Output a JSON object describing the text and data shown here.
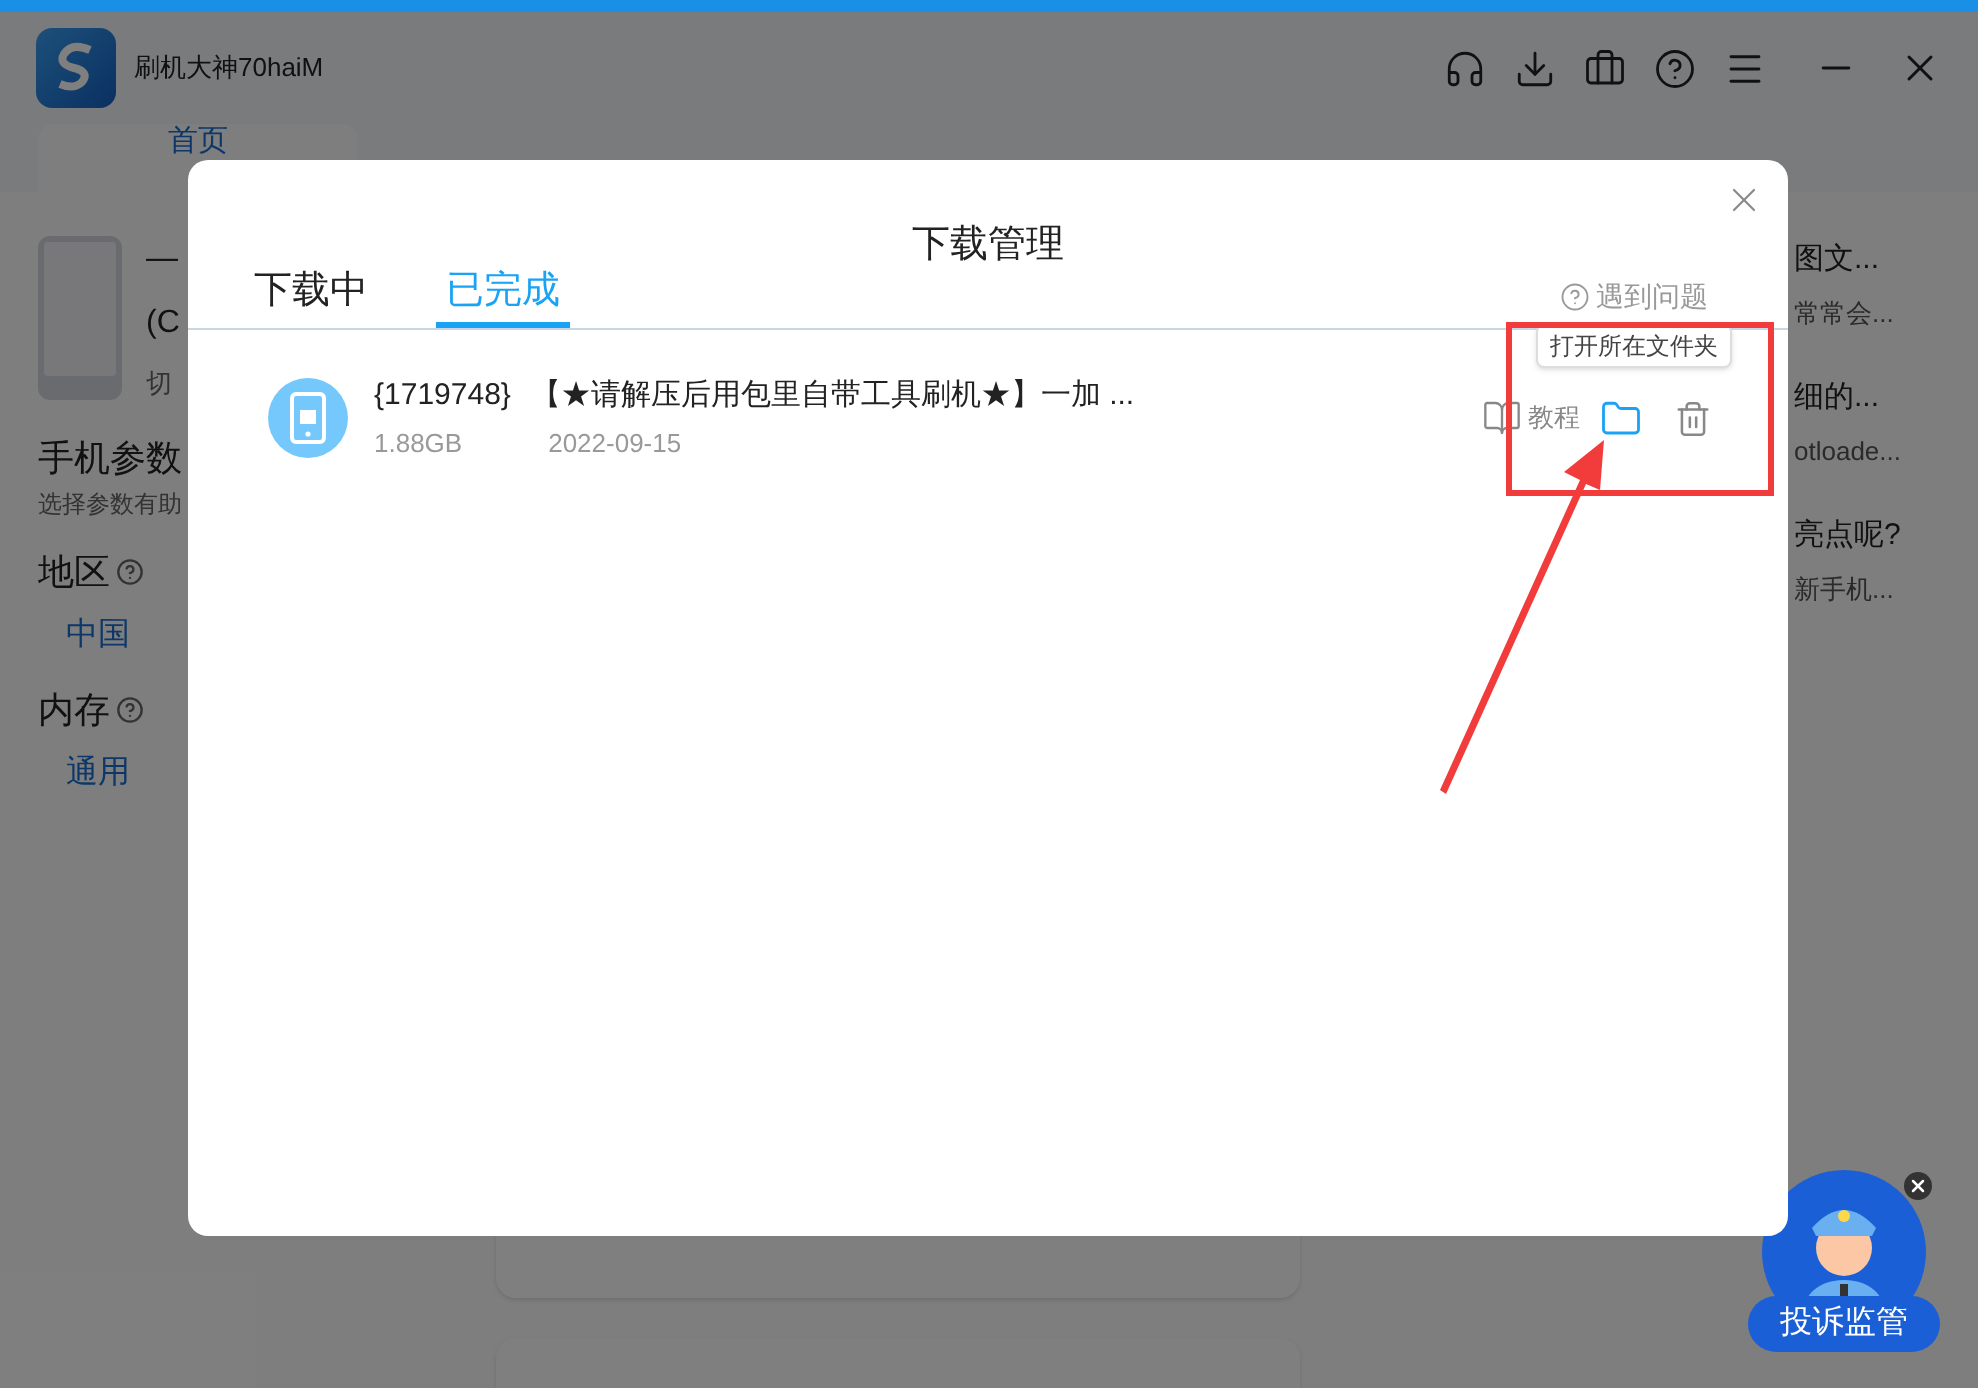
{
  "app": {
    "title": "刷机大神70haiM",
    "home_tab": "首页"
  },
  "device": {
    "name": "—",
    "model": "(C",
    "switch": "切"
  },
  "params": {
    "title": "手机参数",
    "hint": "选择参数有助",
    "fields": [
      {
        "label": "地区",
        "value": "中国"
      },
      {
        "label": "内存",
        "value": "通用"
      }
    ]
  },
  "articles": [
    {
      "title": "图文...",
      "summary": "常常会..."
    },
    {
      "title": "细的...",
      "summary": "otloade..."
    },
    {
      "title": "亮点呢?",
      "summary": "新手机..."
    }
  ],
  "complaint_widget": {
    "label": "投诉监管"
  },
  "dialog": {
    "title": "下载管理",
    "tabs": [
      {
        "label": "下载中",
        "selected": false
      },
      {
        "label": "已完成",
        "selected": true
      }
    ],
    "help_link": "遇到问题",
    "downloads": [
      {
        "id": "{1719748}",
        "name": "【★请解压后用包里自带工具刷机★】一加 ...",
        "size": "1.88GB",
        "date": "2022-09-15",
        "tutorial": "教程",
        "tooltip": "打开所在文件夹"
      }
    ]
  }
}
